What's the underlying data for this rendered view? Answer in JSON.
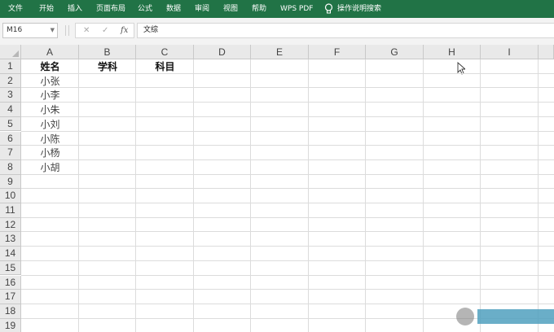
{
  "ribbon": {
    "tabs": [
      "文件",
      "开始",
      "插入",
      "页面布局",
      "公式",
      "数据",
      "审阅",
      "视图",
      "帮助",
      "WPS PDF"
    ],
    "search_label": "操作说明搜索",
    "bg_color": "#217346"
  },
  "formula_bar": {
    "name_box": "M16",
    "formula_value": "文综",
    "fx_label": "fx",
    "cancel_glyph": "✕",
    "confirm_glyph": "✓"
  },
  "sheet": {
    "columns": [
      "A",
      "B",
      "C",
      "D",
      "E",
      "F",
      "G",
      "H",
      "I"
    ],
    "rows": [
      "1",
      "2",
      "3",
      "4",
      "5",
      "6",
      "7",
      "8",
      "9",
      "10",
      "11",
      "12",
      "13",
      "14",
      "15",
      "16",
      "17",
      "18",
      "19"
    ],
    "headers": {
      "A1": "姓名",
      "B1": "学科",
      "C1": "科目"
    },
    "names": [
      "小张",
      "小李",
      "小朱",
      "小刘",
      "小陈",
      "小杨",
      "小胡"
    ]
  }
}
